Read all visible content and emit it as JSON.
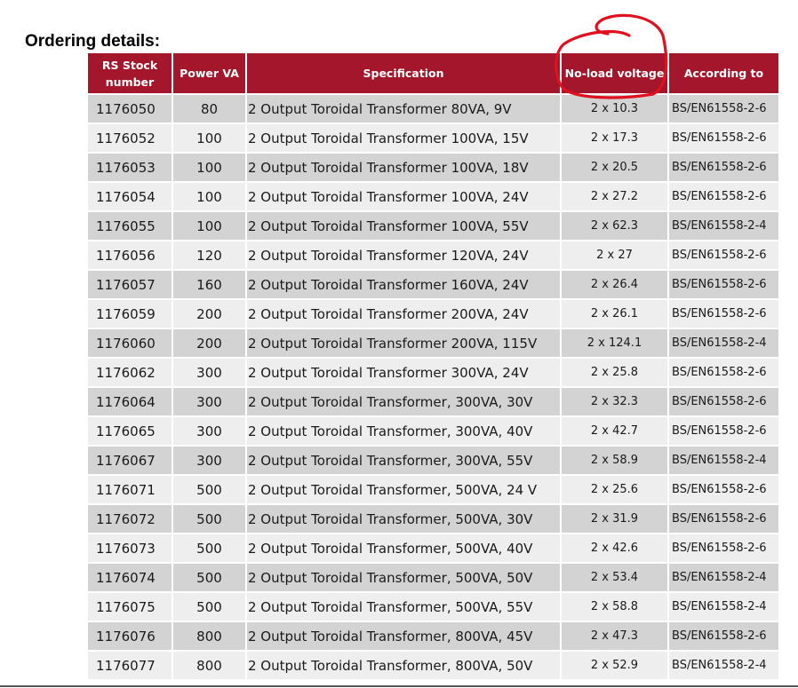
{
  "heading": "Ordering details:",
  "columns": {
    "stock": "RS Stock number",
    "power": "Power VA",
    "spec": "Specification",
    "voltage": "No-load voltage",
    "standard": "According to"
  },
  "rows": [
    {
      "stock": "1176050",
      "power": "80",
      "spec": "2 Output Toroidal Transformer 80VA, 9V",
      "voltage": "2 x 10.3",
      "standard": "BS/EN61558-2-6"
    },
    {
      "stock": "1176052",
      "power": "100",
      "spec": "2 Output Toroidal Transformer 100VA, 15V",
      "voltage": "2 x 17.3",
      "standard": "BS/EN61558-2-6"
    },
    {
      "stock": "1176053",
      "power": "100",
      "spec": "2 Output Toroidal Transformer 100VA, 18V",
      "voltage": "2 x 20.5",
      "standard": "BS/EN61558-2-6"
    },
    {
      "stock": "1176054",
      "power": "100",
      "spec": "2 Output Toroidal Transformer 100VA, 24V",
      "voltage": "2 x 27.2",
      "standard": "BS/EN61558-2-6"
    },
    {
      "stock": "1176055",
      "power": "100",
      "spec": "2 Output Toroidal Transformer 100VA, 55V",
      "voltage": "2 x 62.3",
      "standard": "BS/EN61558-2-4"
    },
    {
      "stock": "1176056",
      "power": "120",
      "spec": "2 Output Toroidal Transformer 120VA, 24V",
      "voltage": "2 x 27",
      "standard": "BS/EN61558-2-6"
    },
    {
      "stock": "1176057",
      "power": "160",
      "spec": "2 Output Toroidal Transformer 160VA, 24V",
      "voltage": "2 x 26.4",
      "standard": "BS/EN61558-2-6"
    },
    {
      "stock": "1176059",
      "power": "200",
      "spec": "2 Output Toroidal Transformer 200VA, 24V",
      "voltage": "2 x 26.1",
      "standard": "BS/EN61558-2-6"
    },
    {
      "stock": "1176060",
      "power": "200",
      "spec": "2 Output Toroidal Transformer 200VA, 115V",
      "voltage": "2 x 124.1",
      "standard": "BS/EN61558-2-4"
    },
    {
      "stock": "1176062",
      "power": "300",
      "spec": "2 Output Toroidal Transformer 300VA, 24V",
      "voltage": "2 x 25.8",
      "standard": "BS/EN61558-2-6"
    },
    {
      "stock": "1176064",
      "power": "300",
      "spec": "2 Output Toroidal Transformer, 300VA, 30V",
      "voltage": "2 x 32.3",
      "standard": "BS/EN61558-2-6"
    },
    {
      "stock": "1176065",
      "power": "300",
      "spec": "2 Output Toroidal Transformer, 300VA, 40V",
      "voltage": "2 x 42.7",
      "standard": "BS/EN61558-2-6"
    },
    {
      "stock": "1176067",
      "power": "300",
      "spec": "2 Output Toroidal Transformer, 300VA, 55V",
      "voltage": "2 x 58.9",
      "standard": "BS/EN61558-2-4"
    },
    {
      "stock": "1176071",
      "power": "500",
      "spec": "2 Output Toroidal Transformer, 500VA, 24 V",
      "voltage": "2 x 25.6",
      "standard": "BS/EN61558-2-6"
    },
    {
      "stock": "1176072",
      "power": "500",
      "spec": "2 Output Toroidal Transformer, 500VA, 30V",
      "voltage": "2 x 31.9",
      "standard": "BS/EN61558-2-6"
    },
    {
      "stock": "1176073",
      "power": "500",
      "spec": "2 Output Toroidal Transformer, 500VA, 40V",
      "voltage": "2 x 42.6",
      "standard": "BS/EN61558-2-6"
    },
    {
      "stock": "1176074",
      "power": "500",
      "spec": "2 Output Toroidal Transformer, 500VA, 50V",
      "voltage": "2 x 53.4",
      "standard": "BS/EN61558-2-4"
    },
    {
      "stock": "1176075",
      "power": "500",
      "spec": "2 Output Toroidal Transformer, 500VA, 55V",
      "voltage": "2 x 58.8",
      "standard": "BS/EN61558-2-4"
    },
    {
      "stock": "1176076",
      "power": "800",
      "spec": "2 Output Toroidal Transformer, 800VA, 45V",
      "voltage": "2 x 47.3",
      "standard": "BS/EN61558-2-6"
    },
    {
      "stock": "1176077",
      "power": "800",
      "spec": "2 Output Toroidal Transformer, 800VA, 50V",
      "voltage": "2 x 52.9",
      "standard": "BS/EN61558-2-4"
    }
  ],
  "colors": {
    "header_bg": "#a4162b",
    "row_dark": "#d3d3d3",
    "row_light": "#eeeeee",
    "annotation": "#e0101e"
  }
}
